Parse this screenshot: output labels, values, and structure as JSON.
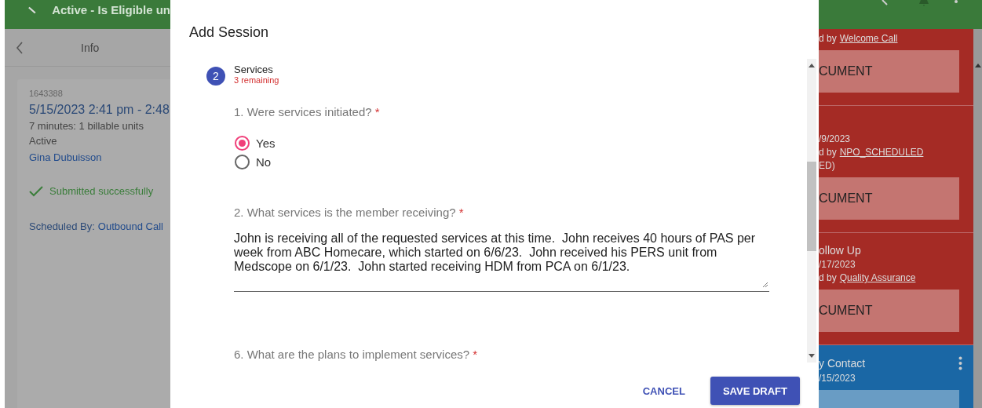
{
  "app_bar": {
    "title": "Active - Is Eligible un"
  },
  "info_panel": {
    "title": "Info",
    "session": {
      "id": "1643388",
      "time_range": "5/15/2023 2:41 pm - 2:48",
      "duration": "7 minutes: 1 billable units",
      "status": "Active",
      "staff": "Gina Dubuisson",
      "submission": "Submitted successfully",
      "scheduled_by_label": "Scheduled By:",
      "scheduled_by": "Outbound Call"
    }
  },
  "dialog": {
    "title": "Add Session",
    "step": {
      "number": "2",
      "title": "Services",
      "remaining": "3 remaining"
    },
    "questions": [
      {
        "kind": "radio",
        "label": "1. Were services initiated?",
        "required_mark": "*",
        "options": [
          {
            "label": "Yes",
            "selected": true
          },
          {
            "label": "No",
            "selected": false
          }
        ]
      },
      {
        "kind": "textarea",
        "label": "2. What services is the member receiving?",
        "required_mark": "*",
        "value": "John is receiving all of the requested services at this time.  John receives 40 hours of PAS per week from ABC Homecare, which started on 6/6/23.  John received his PERS unit from Medscope on 6/1/23.  John started receiving HDM from PCA on 6/1/23."
      },
      {
        "kind": "label",
        "label": "6. What are the plans to implement services?",
        "required_mark": "*"
      }
    ],
    "buttons": [
      {
        "kind": "text",
        "label": "CANCEL"
      },
      {
        "kind": "filled",
        "label": "SAVE DRAFT"
      }
    ]
  },
  "right_panel": {
    "cards": [
      {
        "color": "#a52b25",
        "lines": [
          [
            {
              "text": "d by"
            },
            {
              "text": "Welcome Call",
              "link": true
            }
          ]
        ],
        "button": "CUMENT"
      },
      {
        "color": "#a52b25",
        "lines": [
          [
            {
              "text": "/9/2023"
            }
          ],
          [
            {
              "text": "d by"
            },
            {
              "text": "NPO_SCHEDULED",
              "link": true
            }
          ],
          [
            {
              "text": "ED)"
            }
          ]
        ],
        "button": "CUMENT"
      },
      {
        "color": "#a52b25",
        "title": "ollow Up",
        "lines": [
          [
            {
              "text": "/17/2023"
            }
          ],
          [
            {
              "text": "d by"
            },
            {
              "text": "Quality Assurance",
              "link": true
            }
          ]
        ],
        "button": "CUMENT"
      },
      {
        "color": "#1a67a5",
        "title": "y Contact",
        "lines": [
          [
            {
              "text": "/15/2023"
            }
          ]
        ],
        "menu": true
      }
    ]
  }
}
